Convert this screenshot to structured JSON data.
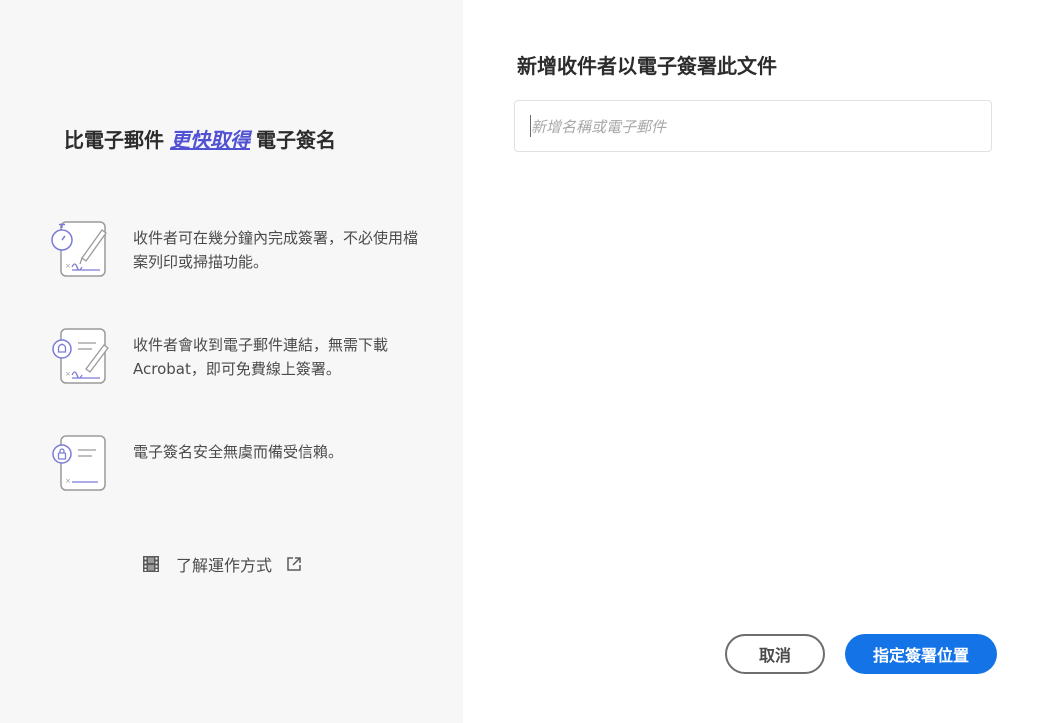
{
  "left": {
    "headline": {
      "prefix": "比電子郵件",
      "accent": "更快取得",
      "suffix": "電子簽名"
    },
    "features": [
      {
        "icon": "stopwatch-sign-document-icon",
        "text": "收件者可在幾分鐘內完成簽署，不必使用檔案列印或掃描功能。"
      },
      {
        "icon": "notification-sign-document-icon",
        "text": "收件者會收到電子郵件連結，無需下載 Acrobat，即可免費線上簽署。"
      },
      {
        "icon": "lock-sign-document-icon",
        "text": "電子簽名安全無虞而備受信賴。"
      }
    ],
    "learn_more": {
      "label": "了解運作方式",
      "icon": "film-icon",
      "external_icon": "external-link-icon"
    }
  },
  "right": {
    "title": "新增收件者以電子簽署此文件",
    "recipient_input": {
      "placeholder": "新增名稱或電子郵件",
      "value": ""
    },
    "buttons": {
      "cancel": "取消",
      "primary": "指定簽署位置"
    }
  },
  "colors": {
    "accent": "#5151d3",
    "primary_button": "#1473e6",
    "left_panel_bg": "#f7f7f7",
    "icon_purple": "#7b7bd6",
    "icon_gray": "#9a9a9a"
  }
}
